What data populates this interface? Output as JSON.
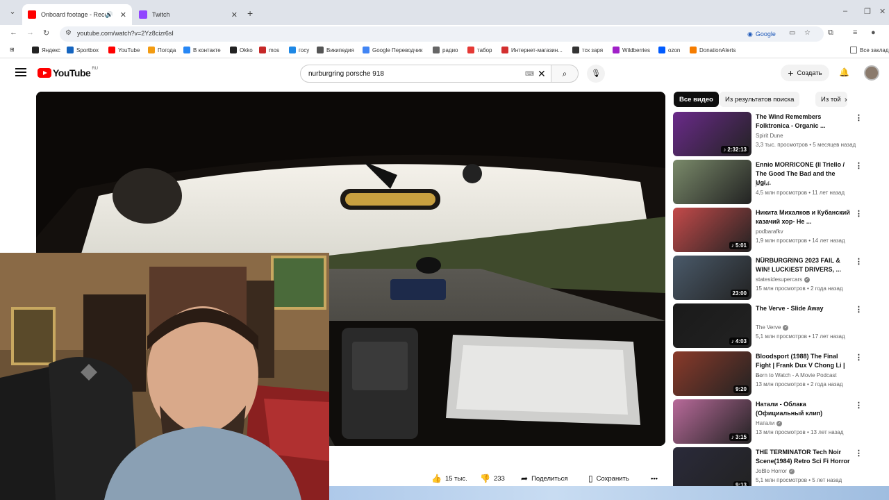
{
  "browser": {
    "tabs": [
      {
        "title": "Onboard footage - Record",
        "active": true,
        "favicon_color": "#ff0000"
      },
      {
        "title": "Twitch",
        "active": false,
        "favicon_color": "#9146ff"
      }
    ],
    "new_tab": "+",
    "window_controls": {
      "minimize": "–",
      "restore": "❐",
      "close": "✕"
    },
    "url": "youtube.com/watch?v=2Yz8cizr6sI",
    "omnibox_google": "Google",
    "bookmarks": [
      {
        "label": "Яндекс",
        "color": "#222222"
      },
      {
        "label": "Sportbox",
        "color": "#1565c0"
      },
      {
        "label": "YouTube",
        "color": "#ff0000"
      },
      {
        "label": "Погода",
        "color": "#f39c12"
      },
      {
        "label": "В контакте",
        "color": "#2787f5"
      },
      {
        "label": "Okko",
        "color": "#222222"
      },
      {
        "label": "mos",
        "color": "#c62828"
      },
      {
        "label": "госу",
        "color": "#1e88e5"
      },
      {
        "label": "Википедия",
        "color": "#555555"
      },
      {
        "label": "Google Переводчик",
        "color": "#4285f4"
      },
      {
        "label": "радио",
        "color": "#666666"
      },
      {
        "label": "табор",
        "color": "#e53935"
      },
      {
        "label": "Интернет-магазин...",
        "color": "#d32f2f"
      },
      {
        "label": "тск заря",
        "color": "#333333"
      },
      {
        "label": "Wildberries",
        "color": "#a020c8"
      },
      {
        "label": "ozon",
        "color": "#005bff"
      },
      {
        "label": "DonationAlerts",
        "color": "#f57c00"
      }
    ],
    "bookmarks_folder": "Все закладки"
  },
  "youtube": {
    "logo_text": "YouTube",
    "logo_region": "RU",
    "search_query": "nurburgring porsche 918",
    "create_label": "Создать",
    "actions": {
      "likes": "15 тыс.",
      "dislikes": "233",
      "share": "Поделиться",
      "save": "Сохранить",
      "more": "•••"
    },
    "chips": [
      "Все видео",
      "Из результатов поиска",
      "Из той"
    ],
    "recommendations": [
      {
        "title": "The Wind Remembers Folktronica - Organic ...",
        "channel": "Spirit Dune",
        "meta": "3,3 тыс. просмотров • 5 месяцев назад",
        "duration": "♪ 2:32:13",
        "verified": false
      },
      {
        "title": "Ennio MORRICONE (Il Triello / The Good The Bad and the Ugl...",
        "channel": "jfneuf",
        "meta": "4,5 млн просмотров • 11 лет назад",
        "duration": "",
        "verified": false
      },
      {
        "title": "Никита Михалков и Кубанский казачий хор- Не ...",
        "channel": "podbarafkv",
        "meta": "1,9 млн просмотров • 14 лет назад",
        "duration": "♪ 5:01",
        "verified": false
      },
      {
        "title": "NÜRBURGRING 2023 FAIL & WIN! LUCKIEST DRIVERS, ...",
        "channel": "statesidesupercars",
        "meta": "15 млн просмотров • 2 года назад",
        "duration": "23:00",
        "verified": true
      },
      {
        "title": "The Verve - Slide Away",
        "channel": "The Verve",
        "meta": "5,1 млн просмотров • 17 лет назад",
        "duration": "♪ 4:03",
        "verified": true
      },
      {
        "title": "Bloodsport (1988) The Final Fight | Frank Dux V Chong Li | ...",
        "channel": "Born to Watch - A Movie Podcast",
        "meta": "13 млн просмотров • 2 года назад",
        "duration": "9:20",
        "verified": false
      },
      {
        "title": "Натали - Облака (Официальный клип)",
        "channel": "Натали",
        "meta": "13 млн просмотров • 13 лет назад",
        "duration": "♪ 3:15",
        "verified": true
      },
      {
        "title": "THE TERMINATOR Tech Noir Scene(1984) Retro Sci Fi Horror",
        "channel": "JoBlo Horror",
        "meta": "5,1 млн просмотров • 5 лет назад",
        "duration": "9:13",
        "verified": true
      }
    ]
  },
  "thumb_palette": [
    "#6a2a8a",
    "#7a8a6a",
    "#c44a4a",
    "#4a5a6a",
    "#1a1a1a",
    "#8a3a2a",
    "#b86a9a",
    "#2a2a3a"
  ],
  "icons": {
    "search": "search-icon",
    "mic": "mic-icon",
    "bell": "bell-icon",
    "like": "thumbs-up-icon",
    "dislike": "thumbs-down-icon",
    "share": "share-icon",
    "save": "save-icon"
  }
}
